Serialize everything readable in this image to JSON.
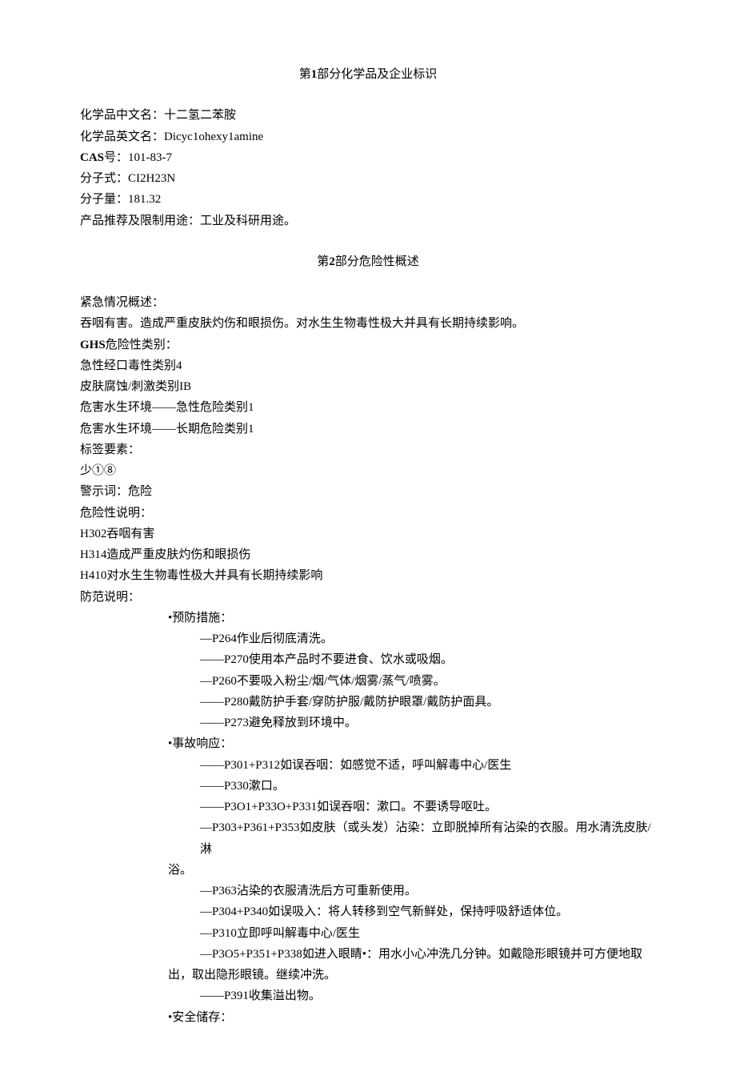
{
  "section1": {
    "title_prefix": "第",
    "title_num": "1",
    "title_suffix": "部分化学品及企业标识",
    "name_cn_label": "化学品中文名：",
    "name_cn_value": "十二氢二苯胺",
    "name_en_label": "化学品英文名：",
    "name_en_value": "Dicyc1ohexy1amine",
    "cas_label": "CAS",
    "cas_suffix": "号：",
    "cas_value": "101-83-7",
    "formula_label": "分子式：",
    "formula_value": "CI2H23N",
    "mw_label": "分子量：",
    "mw_value": "181.32",
    "usage_label": "产品推荐及限制用途：",
    "usage_value": "工业及科研用途。"
  },
  "section2": {
    "title_prefix": "第",
    "title_num": "2",
    "title_suffix": "部分危险性概述",
    "emergency_label": "紧急情况概述：",
    "emergency_text": "吞咽有害。造成严重皮肤灼伤和眼损伤。对水生生物毒性极大并具有长期持续影响。",
    "ghs_label": "GHS",
    "ghs_suffix": "危险性类别：",
    "ghs_lines": [
      "急性经口毒性类别4",
      "皮肤腐蚀/刺激类别IB",
      "危害水生环境——急性危险类别1",
      "危害水生环境——长期危险类别1"
    ],
    "label_elements": "标签要素：",
    "picto": "少①⑧",
    "signal_label": "警示词：",
    "signal_value": "危险",
    "hazard_label": "危险性说明：",
    "hazard_lines": [
      "H302吞咽有害",
      "H314造成严重皮肤灼伤和眼损伤",
      "H410对水生生物毒性极大并具有长期持续影响"
    ],
    "precaution_label": "防范说明：",
    "prevention_header": "•预防措施：",
    "prevention_lines": [
      "—P264作业后彻底清洗。",
      "——P270使用本产品时不要进食、饮水或吸烟。",
      "—P260不要吸入粉尘/烟/气体/烟雾/蒸气/喷雾。",
      "——P280戴防护手套/穿防护服/戴防护眼罩/戴防护面具。",
      "——P273避免释放到环境中。"
    ],
    "response_header": "•事故响应：",
    "response_lines": [
      "——P301+P312如误吞咽：如感觉不适，呼叫解毒中心/医生",
      "——P330漱口。",
      "——P3O1+P33O+P331如误吞咽：漱口。不要诱导呕吐。",
      "—P303+P361+P353如皮肤（或头发）沾染：立即脱掉所有沾染的衣服。用水清洗皮肤/淋",
      "浴。",
      "—P363沾染的衣服清洗后方可重新使用。",
      "—P304+P340如误吸入：将人转移到空气新鲜处，保持呼吸舒适体位。",
      "—P310立即呼叫解毒中心/医生",
      "—P3O5+P351+P338如进入眼睛•：用水小心冲洗几分钟。如戴隐形眼镜并可方便地取",
      "出，取出隐形眼镜。继续冲洗。",
      "——P391收集溢出物。"
    ],
    "storage_header": "•安全储存："
  }
}
